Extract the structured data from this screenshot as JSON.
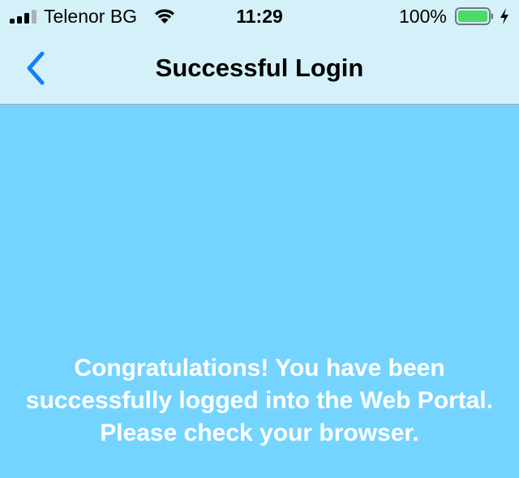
{
  "status_bar": {
    "carrier": "Telenor BG",
    "time": "11:29",
    "battery_percent": "100%",
    "signal_bars_active": 3,
    "signal_bars_total": 4,
    "battery_level": 1.0,
    "charging": true,
    "icons": [
      "signal-icon",
      "wifi-icon",
      "battery-icon",
      "charging-icon"
    ]
  },
  "nav": {
    "title": "Successful Login",
    "back_icon": "chevron-left-icon"
  },
  "main": {
    "message": "Congratulations! You have been successfully logged into the Web Portal. Please check your browser."
  },
  "colors": {
    "nav_background": "#d4f1f9",
    "content_background": "#75d4fe",
    "accent": "#147efb",
    "battery_fill": "#4cd964",
    "message_text": "#ffffff"
  }
}
